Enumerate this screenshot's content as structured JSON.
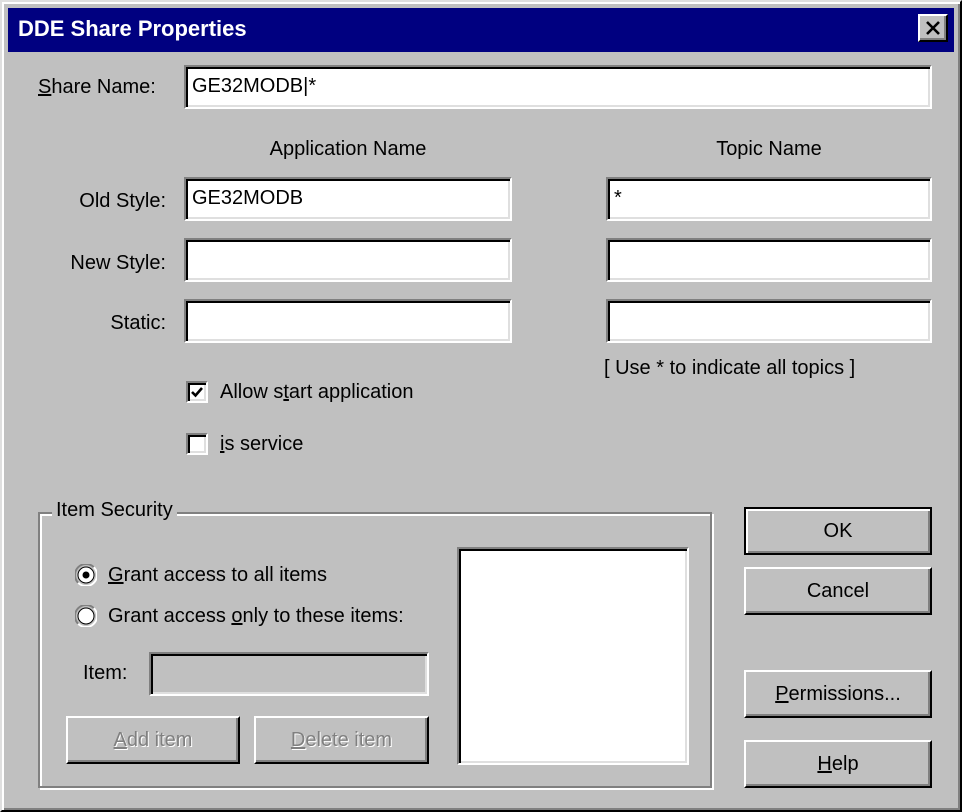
{
  "window": {
    "title": "DDE Share Properties",
    "close_glyph": "✕"
  },
  "share_name": {
    "label": "Share Name:",
    "value": "GE32MODB|*"
  },
  "columns": {
    "application": "Application Name",
    "topic": "Topic Name"
  },
  "rows": [
    {
      "label": "Old Style:",
      "application": "GE32MODB",
      "topic": "*"
    },
    {
      "label": "New Style:",
      "application": "",
      "topic": ""
    },
    {
      "label": "Static:",
      "application": "",
      "topic": ""
    }
  ],
  "topic_hint": "[ Use * to indicate all topics ]",
  "options": {
    "allow_start": {
      "label": "Allow start application",
      "checked": true
    },
    "is_service": {
      "label": "is service",
      "checked": false
    }
  },
  "item_security": {
    "title": "Item Security",
    "grant_all": {
      "label": "Grant access to all items",
      "selected": true
    },
    "grant_only": {
      "label": "Grant access only to these items:",
      "selected": false
    },
    "item_label": "Item:",
    "item_value": "",
    "add_button": "Add item",
    "delete_button": "Delete item",
    "items": []
  },
  "buttons": {
    "ok": "OK",
    "cancel": "Cancel",
    "permissions": "Permissions...",
    "help": "Help"
  },
  "colors": {
    "face": "#c0c0c0",
    "title_bar": "#000080",
    "disabled_text": "#808080"
  }
}
